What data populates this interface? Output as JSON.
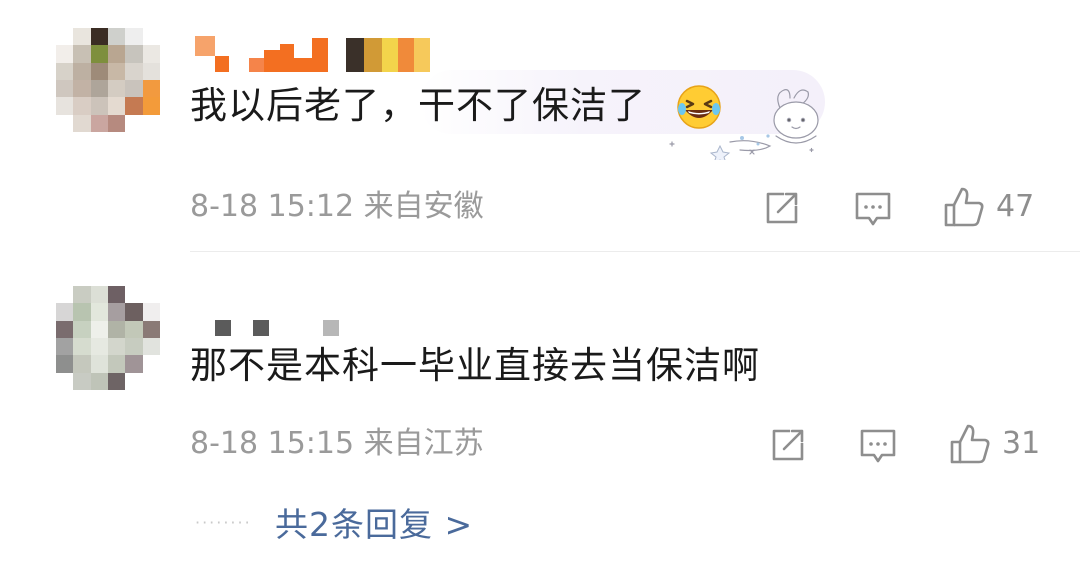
{
  "comments": [
    {
      "text": "我以后老了，干不了保洁了",
      "time": "8-18 15:12 来自安徽",
      "like_count": "47",
      "emoji": "grinning-squinting-tears-emoji"
    },
    {
      "text": "那不是本科一毕业直接去当保洁啊",
      "time": "8-18 15:15 来自江苏",
      "like_count": "31"
    }
  ],
  "replies": {
    "label": "共2条回复 >"
  },
  "icons": {
    "share": "share-icon",
    "comment": "comment-icon",
    "like": "thumbs-up-icon"
  },
  "colors": {
    "username_orange": "#f36f21",
    "link_blue": "#4a6a9b",
    "meta_gray": "#9a9a9a",
    "text_dark": "#1a1a1a"
  }
}
